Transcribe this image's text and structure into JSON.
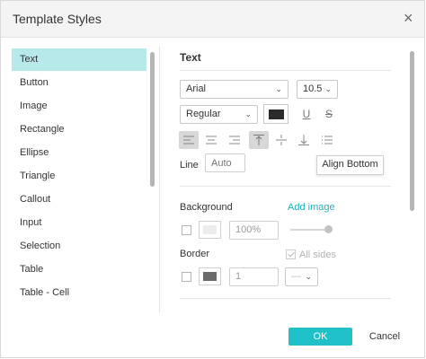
{
  "dialog": {
    "title": "Template Styles",
    "close_icon": "close-icon"
  },
  "sidebar": {
    "items": [
      {
        "label": "Text",
        "active": true
      },
      {
        "label": "Button"
      },
      {
        "label": "Image"
      },
      {
        "label": "Rectangle"
      },
      {
        "label": "Ellipse"
      },
      {
        "label": "Triangle"
      },
      {
        "label": "Callout"
      },
      {
        "label": "Input"
      },
      {
        "label": "Selection"
      },
      {
        "label": "Table"
      },
      {
        "label": "Table - Cell"
      }
    ]
  },
  "text_section": {
    "title": "Text",
    "font_family": "Arial",
    "font_size": "10.5",
    "font_weight": "Regular",
    "text_color": "#2b2b2b",
    "underline_label": "U",
    "strike_label": "S",
    "align_buttons": [
      "align-left-icon",
      "align-center-icon",
      "align-right-icon",
      "align-top-icon",
      "align-middle-icon",
      "align-bottom-icon",
      "list-icon"
    ],
    "line_label": "Line",
    "line_value_placeholder": "Auto",
    "tooltip": "Align Bottom"
  },
  "background_section": {
    "title": "Background",
    "add_image_label": "Add image",
    "opacity_value": "100%",
    "opacity_fraction": 1.0
  },
  "border_section": {
    "title": "Border",
    "all_sides_label": "All sides",
    "all_sides_checked": true,
    "width_value": "1",
    "style_value": "—",
    "color": "#6b6b6b"
  },
  "footer": {
    "ok_label": "OK",
    "cancel_label": "Cancel"
  }
}
